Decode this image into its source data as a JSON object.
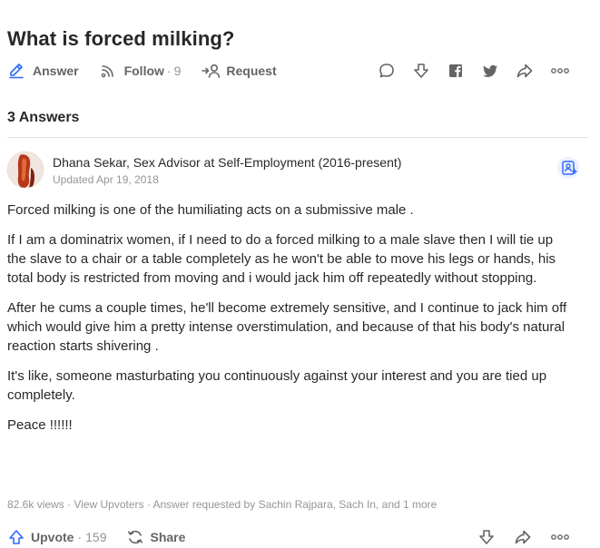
{
  "question": {
    "title": "What is forced milking?",
    "actions": {
      "answer_label": "Answer",
      "follow_label": "Follow",
      "follow_sep": "·",
      "follow_count": "9",
      "request_label": "Request"
    },
    "icons": [
      "pencil-icon",
      "wifi-follow-icon",
      "request-arrow-person-icon",
      "comment-icon",
      "downvote-icon",
      "facebook-icon",
      "twitter-icon",
      "share-icon",
      "more-icon"
    ]
  },
  "answers_header": "3 Answers",
  "answer": {
    "author_line": "Dhana Sekar, Sex Advisor at Self-Employment (2016-present)",
    "date": "Updated Apr 19, 2018",
    "paragraphs": [
      "Forced milking is one of the humiliating acts on a submissive male .",
      "If I am a dominatrix women, if I need to do a forced milking to a male slave then I will tie up the slave to a chair or a table completely as he won't be able to move his legs or hands, his total body is restricted from moving and i would jack him off repeatedly without stopping.",
      "After he cums a couple times, he'll become extremely sensitive, and I continue to jack him off which would give him a pretty intense overstimulation, and because of that his body's natural reaction starts shivering .",
      "It's like, someone masturbating you continuously against your interest and you are tied up completely.",
      "Peace !!!!!!"
    ],
    "meta": "82.6k views · View Upvoters · Answer requested by Sachin Rajpara, Sach In, and 1 more",
    "upvote_label": "Upvote",
    "upvote_sep": "·",
    "upvote_count": "159",
    "share_label": "Share"
  },
  "colors": {
    "text": "#282829",
    "muted": "#636466",
    "light": "#939598",
    "accent": "#2e69ff",
    "divider": "#dee0e1"
  }
}
